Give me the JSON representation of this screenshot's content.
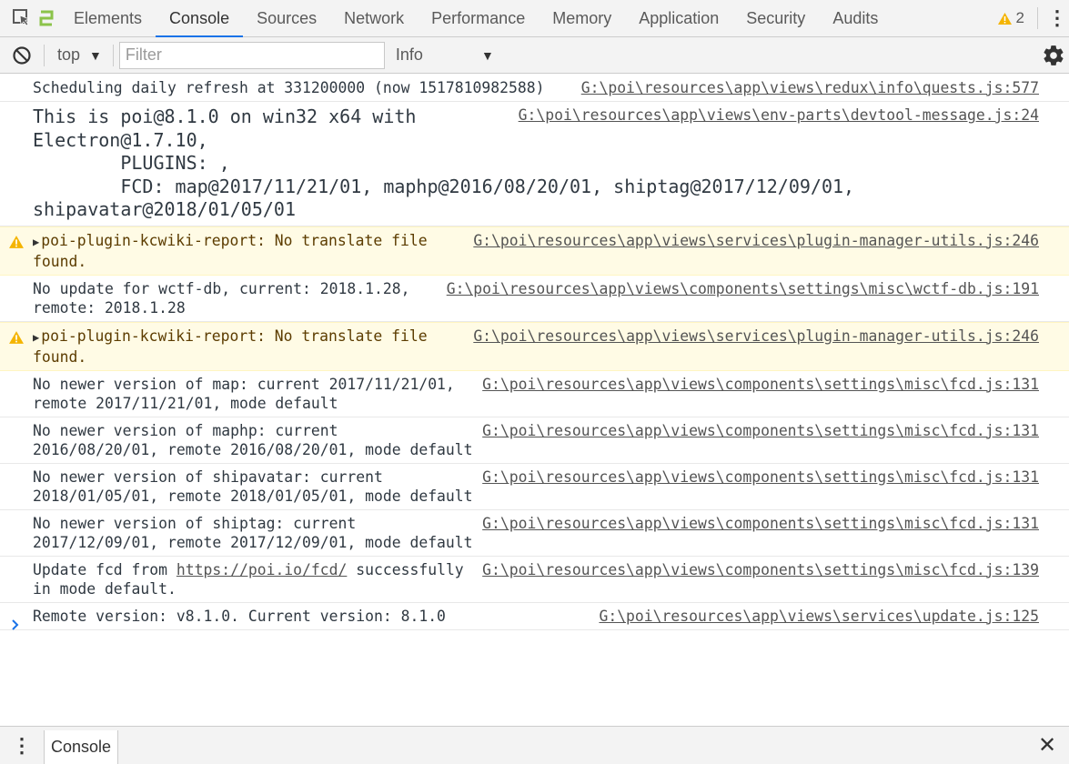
{
  "tabbar": {
    "tabs": [
      {
        "label": "Elements",
        "active": false
      },
      {
        "label": "Console",
        "active": true
      },
      {
        "label": "Sources",
        "active": false
      },
      {
        "label": "Network",
        "active": false
      },
      {
        "label": "Performance",
        "active": false
      },
      {
        "label": "Memory",
        "active": false
      },
      {
        "label": "Application",
        "active": false
      },
      {
        "label": "Security",
        "active": false
      },
      {
        "label": "Audits",
        "active": false
      }
    ],
    "warning_count": "2",
    "accent_color": "#1a73e8"
  },
  "toolbar": {
    "context": "top",
    "filter_placeholder": "Filter",
    "level": "Info"
  },
  "messages": [
    {
      "text": "Scheduling daily refresh at 331200000 (now 1517810982588)",
      "source": "G:\\poi\\resources\\app\\views\\redux\\info\\quests.js:577"
    },
    {
      "text": "This is poi@8.1.0 on win32 x64 with\nElectron@1.7.10,\n        PLUGINS: ,\n        FCD: map@2017/11/21/01, maphp@2016/08/20/01, shiptag@2017/12/09/01,\nshipavatar@2018/01/05/01",
      "source": "G:\\poi\\resources\\app\\views\\env-parts\\devtool-message.js:24"
    },
    {
      "text": "poi-plugin-kcwiki-report: No translate file\nfound.",
      "source": "G:\\poi\\resources\\app\\views\\services\\plugin-manager-utils.js:246"
    },
    {
      "text": "No update for wctf-db, current: 2018.1.28,\nremote: 2018.1.28",
      "source": "G:\\poi\\resources\\app\\views\\components\\settings\\misc\\wctf-db.js:191"
    },
    {
      "text": "poi-plugin-kcwiki-report: No translate file\nfound.",
      "source": "G:\\poi\\resources\\app\\views\\services\\plugin-manager-utils.js:246"
    },
    {
      "text": "No newer version of map: current 2017/11/21/01,\nremote 2017/11/21/01, mode default",
      "source": "G:\\poi\\resources\\app\\views\\components\\settings\\misc\\fcd.js:131"
    },
    {
      "text": "No newer version of maphp: current\n2016/08/20/01, remote 2016/08/20/01, mode default",
      "source": "G:\\poi\\resources\\app\\views\\components\\settings\\misc\\fcd.js:131"
    },
    {
      "text": "No newer version of shipavatar: current\n2018/01/05/01, remote 2018/01/05/01, mode default",
      "source": "G:\\poi\\resources\\app\\views\\components\\settings\\misc\\fcd.js:131"
    },
    {
      "text": "No newer version of shiptag: current\n2017/12/09/01, remote 2017/12/09/01, mode default",
      "source": "G:\\poi\\resources\\app\\views\\components\\settings\\misc\\fcd.js:131"
    },
    {
      "text_before": "Update fcd from ",
      "link": "https://poi.io/fcd/",
      "text_after": " successfully\nin mode default.",
      "source": "G:\\poi\\resources\\app\\views\\components\\settings\\misc\\fcd.js:139"
    },
    {
      "text": "Remote version: v8.1.0. Current version: 8.1.0",
      "source": "G:\\poi\\resources\\app\\views\\services\\update.js:125"
    }
  ],
  "drawer": {
    "tab_label": "Console"
  },
  "colors": {
    "warning_bg": "#fffbe5",
    "warning_icon": "#f4b400",
    "prompt": "#1a73e8"
  }
}
